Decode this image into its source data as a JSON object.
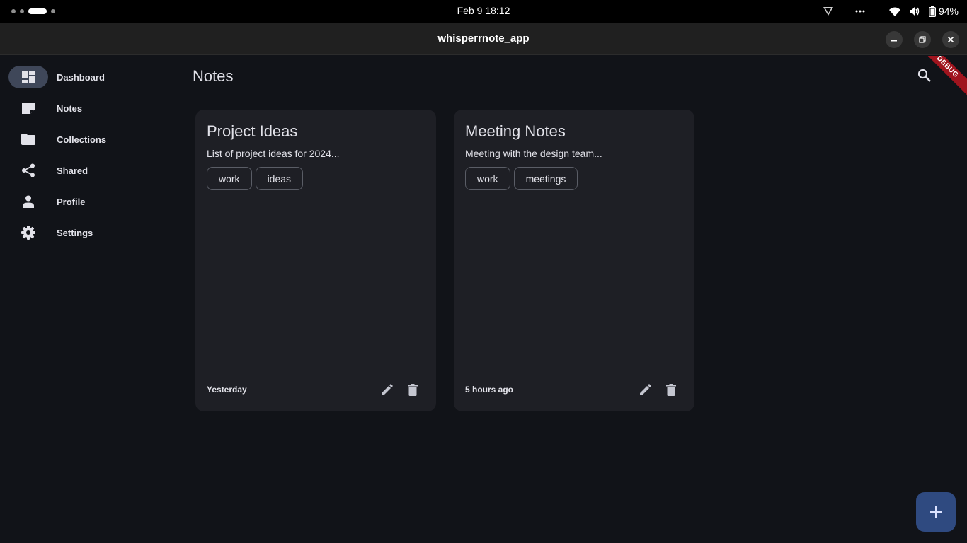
{
  "system_bar": {
    "clock": "Feb 9  18:12",
    "battery": "94%",
    "overflow_icon": "ellipsis-icon"
  },
  "window": {
    "title": "whisperrnote_app"
  },
  "nav": {
    "items": [
      {
        "label": "Dashboard",
        "icon": "dashboard-icon",
        "active": true
      },
      {
        "label": "Notes",
        "icon": "note-icon"
      },
      {
        "label": "Collections",
        "icon": "folder-icon"
      },
      {
        "label": "Shared",
        "icon": "share-icon"
      },
      {
        "label": "Profile",
        "icon": "person-icon"
      },
      {
        "label": "Settings",
        "icon": "gear-icon"
      }
    ]
  },
  "page": {
    "title": "Notes",
    "debug_banner": "DEBUG"
  },
  "notes": [
    {
      "title": "Project Ideas",
      "preview": "List of project ideas for 2024...",
      "tags": [
        "work",
        "ideas"
      ],
      "updated": "Yesterday"
    },
    {
      "title": "Meeting Notes",
      "preview": "Meeting with the design team...",
      "tags": [
        "work",
        "meetings"
      ],
      "updated": "5 hours ago"
    }
  ],
  "colors": {
    "background": "#111318",
    "card": "#1e1f25",
    "nav_active": "#3f4759",
    "fab": "#2f4a80",
    "debug": "#a0141e"
  }
}
